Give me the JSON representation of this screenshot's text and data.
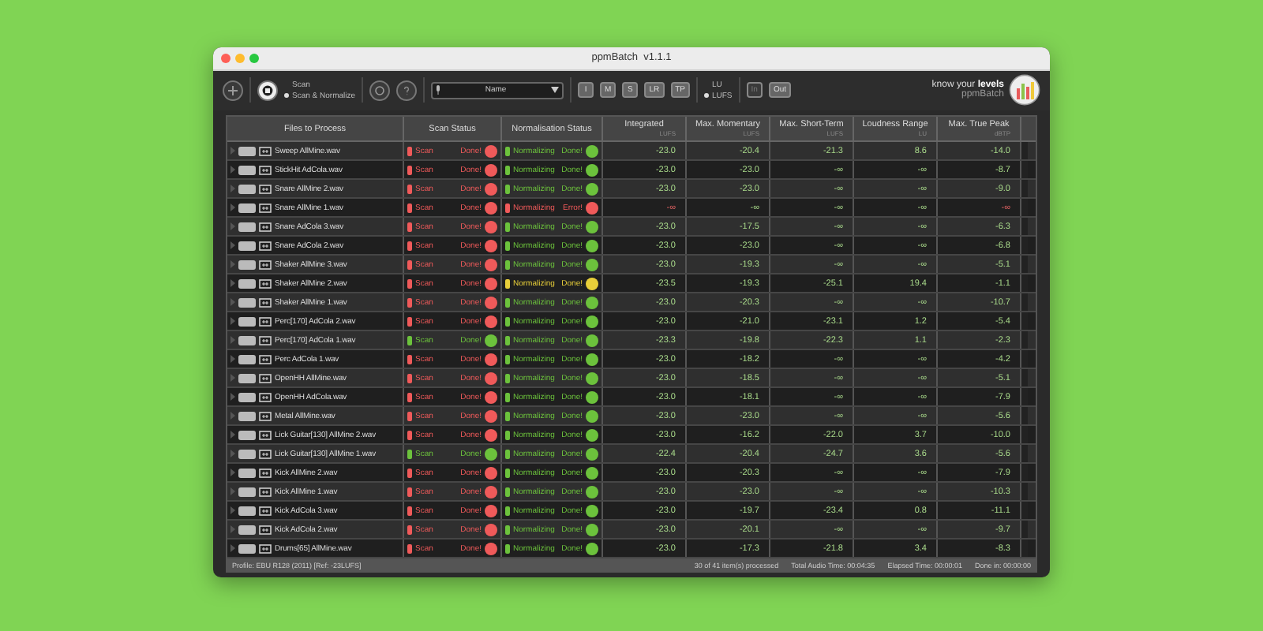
{
  "window": {
    "title": "ppmBatch  v1.1.1"
  },
  "toolbar": {
    "mode_options": [
      {
        "label": "Scan",
        "selected": false
      },
      {
        "label": "Scan & Normalize",
        "selected": true
      }
    ],
    "sort_field": {
      "value": "Name"
    },
    "meter_buttons": [
      {
        "label": "I"
      },
      {
        "label": "M"
      },
      {
        "label": "S"
      },
      {
        "label": "LR"
      },
      {
        "label": "TP"
      }
    ],
    "units": [
      {
        "label": "LU",
        "selected": false
      },
      {
        "label": "LUFS",
        "selected": true
      }
    ],
    "monitor_buttons": [
      {
        "label": "In",
        "disabled": true
      },
      {
        "label": "Out",
        "disabled": false
      }
    ]
  },
  "brand": {
    "tagline": "know your **levels**",
    "name": "ppmBatch"
  },
  "table": {
    "columns": [
      {
        "title": "Files to Process"
      },
      {
        "title": "Scan Status"
      },
      {
        "title": "Normalisation Status"
      },
      {
        "title": "Integrated",
        "unit": "LUFS"
      },
      {
        "title": "Max. Momentary",
        "unit": "LUFS"
      },
      {
        "title": "Max. Short-Term",
        "unit": "LUFS"
      },
      {
        "title": "Loudness Range",
        "unit": "LU"
      },
      {
        "title": "Max. True Peak",
        "unit": "dBTP"
      }
    ],
    "rows": [
      {
        "file": "Sweep AllMine.wav",
        "scan": {
          "label": "Scan",
          "result": "Done!",
          "color": "#f05a5a"
        },
        "normalisation": {
          "label": "Normalizing",
          "result": "Done!",
          "color": "#6cc23c"
        },
        "values": [
          {
            "text": "-23.0",
            "alert": false
          },
          {
            "text": "-20.4",
            "alert": false
          },
          {
            "text": "-21.3",
            "alert": false
          },
          {
            "text": "8.6",
            "alert": false
          },
          {
            "text": "-14.0",
            "alert": false
          }
        ]
      },
      {
        "file": "StickHit AdCola.wav",
        "scan": {
          "label": "Scan",
          "result": "Done!",
          "color": "#f05a5a"
        },
        "normalisation": {
          "label": "Normalizing",
          "result": "Done!",
          "color": "#6cc23c"
        },
        "values": [
          {
            "text": "-23.0",
            "alert": false
          },
          {
            "text": "-23.0",
            "alert": false
          },
          {
            "text": "-∞",
            "alert": false
          },
          {
            "text": "-∞",
            "alert": false
          },
          {
            "text": "-8.7",
            "alert": false
          }
        ]
      },
      {
        "file": "Snare AllMine 2.wav",
        "scan": {
          "label": "Scan",
          "result": "Done!",
          "color": "#f05a5a"
        },
        "normalisation": {
          "label": "Normalizing",
          "result": "Done!",
          "color": "#6cc23c"
        },
        "values": [
          {
            "text": "-23.0",
            "alert": false
          },
          {
            "text": "-23.0",
            "alert": false
          },
          {
            "text": "-∞",
            "alert": false
          },
          {
            "text": "-∞",
            "alert": false
          },
          {
            "text": "-9.0",
            "alert": false
          }
        ]
      },
      {
        "file": "Snare AllMine 1.wav",
        "scan": {
          "label": "Scan",
          "result": "Done!",
          "color": "#f05a5a"
        },
        "normalisation": {
          "label": "Normalizing",
          "result": "Error!",
          "color": "#f05a5a"
        },
        "values": [
          {
            "text": "-∞",
            "alert": true
          },
          {
            "text": "-∞",
            "alert": false
          },
          {
            "text": "-∞",
            "alert": false
          },
          {
            "text": "-∞",
            "alert": false
          },
          {
            "text": "-∞",
            "alert": true
          }
        ]
      },
      {
        "file": "Snare AdCola 3.wav",
        "scan": {
          "label": "Scan",
          "result": "Done!",
          "color": "#f05a5a"
        },
        "normalisation": {
          "label": "Normalizing",
          "result": "Done!",
          "color": "#6cc23c"
        },
        "values": [
          {
            "text": "-23.0",
            "alert": false
          },
          {
            "text": "-17.5",
            "alert": false
          },
          {
            "text": "-∞",
            "alert": false
          },
          {
            "text": "-∞",
            "alert": false
          },
          {
            "text": "-6.3",
            "alert": false
          }
        ]
      },
      {
        "file": "Snare AdCola 2.wav",
        "scan": {
          "label": "Scan",
          "result": "Done!",
          "color": "#f05a5a"
        },
        "normalisation": {
          "label": "Normalizing",
          "result": "Done!",
          "color": "#6cc23c"
        },
        "values": [
          {
            "text": "-23.0",
            "alert": false
          },
          {
            "text": "-23.0",
            "alert": false
          },
          {
            "text": "-∞",
            "alert": false
          },
          {
            "text": "-∞",
            "alert": false
          },
          {
            "text": "-6.8",
            "alert": false
          }
        ]
      },
      {
        "file": "Shaker AllMine 3.wav",
        "scan": {
          "label": "Scan",
          "result": "Done!",
          "color": "#f05a5a"
        },
        "normalisation": {
          "label": "Normalizing",
          "result": "Done!",
          "color": "#6cc23c"
        },
        "values": [
          {
            "text": "-23.0",
            "alert": false
          },
          {
            "text": "-19.3",
            "alert": false
          },
          {
            "text": "-∞",
            "alert": false
          },
          {
            "text": "-∞",
            "alert": false
          },
          {
            "text": "-5.1",
            "alert": false
          }
        ]
      },
      {
        "file": "Shaker AllMine 2.wav",
        "scan": {
          "label": "Scan",
          "result": "Done!",
          "color": "#f05a5a"
        },
        "normalisation": {
          "label": "Normalizing",
          "result": "Done!",
          "color": "#e8cf3a"
        },
        "values": [
          {
            "text": "-23.5",
            "alert": false
          },
          {
            "text": "-19.3",
            "alert": false
          },
          {
            "text": "-25.1",
            "alert": false
          },
          {
            "text": "19.4",
            "alert": false
          },
          {
            "text": "-1.1",
            "alert": false
          }
        ]
      },
      {
        "file": "Shaker AllMine 1.wav",
        "scan": {
          "label": "Scan",
          "result": "Done!",
          "color": "#f05a5a"
        },
        "normalisation": {
          "label": "Normalizing",
          "result": "Done!",
          "color": "#6cc23c"
        },
        "values": [
          {
            "text": "-23.0",
            "alert": false
          },
          {
            "text": "-20.3",
            "alert": false
          },
          {
            "text": "-∞",
            "alert": false
          },
          {
            "text": "-∞",
            "alert": false
          },
          {
            "text": "-10.7",
            "alert": false
          }
        ]
      },
      {
        "file": "Perc[170] AdCola 2.wav",
        "scan": {
          "label": "Scan",
          "result": "Done!",
          "color": "#f05a5a"
        },
        "normalisation": {
          "label": "Normalizing",
          "result": "Done!",
          "color": "#6cc23c"
        },
        "values": [
          {
            "text": "-23.0",
            "alert": false
          },
          {
            "text": "-21.0",
            "alert": false
          },
          {
            "text": "-23.1",
            "alert": false
          },
          {
            "text": "1.2",
            "alert": false
          },
          {
            "text": "-5.4",
            "alert": false
          }
        ]
      },
      {
        "file": "Perc[170] AdCola 1.wav",
        "scan": {
          "label": "Scan",
          "result": "Done!",
          "color": "#6cc23c"
        },
        "normalisation": {
          "label": "Normalizing",
          "result": "Done!",
          "color": "#6cc23c"
        },
        "values": [
          {
            "text": "-23.3",
            "alert": false
          },
          {
            "text": "-19.8",
            "alert": false
          },
          {
            "text": "-22.3",
            "alert": false
          },
          {
            "text": "1.1",
            "alert": false
          },
          {
            "text": "-2.3",
            "alert": false
          }
        ]
      },
      {
        "file": "Perc AdCola 1.wav",
        "scan": {
          "label": "Scan",
          "result": "Done!",
          "color": "#f05a5a"
        },
        "normalisation": {
          "label": "Normalizing",
          "result": "Done!",
          "color": "#6cc23c"
        },
        "values": [
          {
            "text": "-23.0",
            "alert": false
          },
          {
            "text": "-18.2",
            "alert": false
          },
          {
            "text": "-∞",
            "alert": false
          },
          {
            "text": "-∞",
            "alert": false
          },
          {
            "text": "-4.2",
            "alert": false
          }
        ]
      },
      {
        "file": "OpenHH AllMine.wav",
        "scan": {
          "label": "Scan",
          "result": "Done!",
          "color": "#f05a5a"
        },
        "normalisation": {
          "label": "Normalizing",
          "result": "Done!",
          "color": "#6cc23c"
        },
        "values": [
          {
            "text": "-23.0",
            "alert": false
          },
          {
            "text": "-18.5",
            "alert": false
          },
          {
            "text": "-∞",
            "alert": false
          },
          {
            "text": "-∞",
            "alert": false
          },
          {
            "text": "-5.1",
            "alert": false
          }
        ]
      },
      {
        "file": "OpenHH AdCola.wav",
        "scan": {
          "label": "Scan",
          "result": "Done!",
          "color": "#f05a5a"
        },
        "normalisation": {
          "label": "Normalizing",
          "result": "Done!",
          "color": "#6cc23c"
        },
        "values": [
          {
            "text": "-23.0",
            "alert": false
          },
          {
            "text": "-18.1",
            "alert": false
          },
          {
            "text": "-∞",
            "alert": false
          },
          {
            "text": "-∞",
            "alert": false
          },
          {
            "text": "-7.9",
            "alert": false
          }
        ]
      },
      {
        "file": "Metal AllMine.wav",
        "scan": {
          "label": "Scan",
          "result": "Done!",
          "color": "#f05a5a"
        },
        "normalisation": {
          "label": "Normalizing",
          "result": "Done!",
          "color": "#6cc23c"
        },
        "values": [
          {
            "text": "-23.0",
            "alert": false
          },
          {
            "text": "-23.0",
            "alert": false
          },
          {
            "text": "-∞",
            "alert": false
          },
          {
            "text": "-∞",
            "alert": false
          },
          {
            "text": "-5.6",
            "alert": false
          }
        ]
      },
      {
        "file": "Lick Guitar[130] AllMine 2.wav",
        "scan": {
          "label": "Scan",
          "result": "Done!",
          "color": "#f05a5a"
        },
        "normalisation": {
          "label": "Normalizing",
          "result": "Done!",
          "color": "#6cc23c"
        },
        "values": [
          {
            "text": "-23.0",
            "alert": false
          },
          {
            "text": "-16.2",
            "alert": false
          },
          {
            "text": "-22.0",
            "alert": false
          },
          {
            "text": "3.7",
            "alert": false
          },
          {
            "text": "-10.0",
            "alert": false
          }
        ]
      },
      {
        "file": "Lick Guitar[130] AllMine 1.wav",
        "scan": {
          "label": "Scan",
          "result": "Done!",
          "color": "#6cc23c"
        },
        "normalisation": {
          "label": "Normalizing",
          "result": "Done!",
          "color": "#6cc23c"
        },
        "values": [
          {
            "text": "-22.4",
            "alert": false
          },
          {
            "text": "-20.4",
            "alert": false
          },
          {
            "text": "-24.7",
            "alert": false
          },
          {
            "text": "3.6",
            "alert": false
          },
          {
            "text": "-5.6",
            "alert": false
          }
        ]
      },
      {
        "file": "Kick AllMine 2.wav",
        "scan": {
          "label": "Scan",
          "result": "Done!",
          "color": "#f05a5a"
        },
        "normalisation": {
          "label": "Normalizing",
          "result": "Done!",
          "color": "#6cc23c"
        },
        "values": [
          {
            "text": "-23.0",
            "alert": false
          },
          {
            "text": "-20.3",
            "alert": false
          },
          {
            "text": "-∞",
            "alert": false
          },
          {
            "text": "-∞",
            "alert": false
          },
          {
            "text": "-7.9",
            "alert": false
          }
        ]
      },
      {
        "file": "Kick AllMine 1.wav",
        "scan": {
          "label": "Scan",
          "result": "Done!",
          "color": "#f05a5a"
        },
        "normalisation": {
          "label": "Normalizing",
          "result": "Done!",
          "color": "#6cc23c"
        },
        "values": [
          {
            "text": "-23.0",
            "alert": false
          },
          {
            "text": "-23.0",
            "alert": false
          },
          {
            "text": "-∞",
            "alert": false
          },
          {
            "text": "-∞",
            "alert": false
          },
          {
            "text": "-10.3",
            "alert": false
          }
        ]
      },
      {
        "file": "Kick AdCola 3.wav",
        "scan": {
          "label": "Scan",
          "result": "Done!",
          "color": "#f05a5a"
        },
        "normalisation": {
          "label": "Normalizing",
          "result": "Done!",
          "color": "#6cc23c"
        },
        "values": [
          {
            "text": "-23.0",
            "alert": false
          },
          {
            "text": "-19.7",
            "alert": false
          },
          {
            "text": "-23.4",
            "alert": false
          },
          {
            "text": "0.8",
            "alert": false
          },
          {
            "text": "-11.1",
            "alert": false
          }
        ]
      },
      {
        "file": "Kick AdCola 2.wav",
        "scan": {
          "label": "Scan",
          "result": "Done!",
          "color": "#f05a5a"
        },
        "normalisation": {
          "label": "Normalizing",
          "result": "Done!",
          "color": "#6cc23c"
        },
        "values": [
          {
            "text": "-23.0",
            "alert": false
          },
          {
            "text": "-20.1",
            "alert": false
          },
          {
            "text": "-∞",
            "alert": false
          },
          {
            "text": "-∞",
            "alert": false
          },
          {
            "text": "-9.7",
            "alert": false
          }
        ]
      },
      {
        "file": "Drums[65] AllMine.wav",
        "scan": {
          "label": "Scan",
          "result": "Done!",
          "color": "#f05a5a"
        },
        "normalisation": {
          "label": "Normalizing",
          "result": "Done!",
          "color": "#6cc23c"
        },
        "values": [
          {
            "text": "-23.0",
            "alert": false
          },
          {
            "text": "-17.3",
            "alert": false
          },
          {
            "text": "-21.8",
            "alert": false
          },
          {
            "text": "3.4",
            "alert": false
          },
          {
            "text": "-8.3",
            "alert": false
          }
        ]
      }
    ]
  },
  "status_bar": {
    "profile": "Profile: EBU R128 (2011) [Ref: -23LUFS]",
    "processed": "30 of 41 item(s) processed",
    "total_audio_time": "Total Audio Time: 00:04:35",
    "elapsed_time": "Elapsed Time: 00:00:01",
    "done_in": "Done in: 00:00:00"
  }
}
